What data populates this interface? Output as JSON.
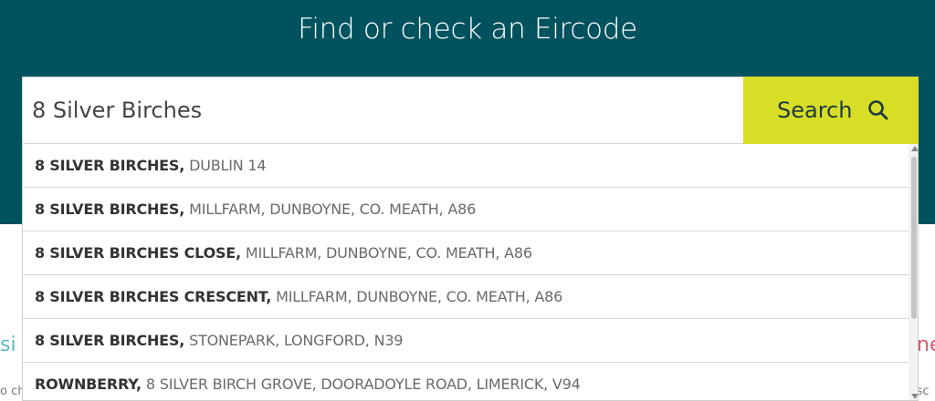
{
  "header": {
    "title": "Find or check an Eircode"
  },
  "search": {
    "value": "8 Silver Birches",
    "placeholder": "",
    "button_label": "Search",
    "icon": "search-icon"
  },
  "suggestions": [
    {
      "primary": "8 SILVER BIRCHES,",
      "secondary": "DUBLIN 14"
    },
    {
      "primary": "8 SILVER BIRCHES,",
      "secondary": "MILLFARM, DUNBOYNE, CO. MEATH, A86"
    },
    {
      "primary": "8 SILVER BIRCHES CLOSE,",
      "secondary": "MILLFARM, DUNBOYNE, CO. MEATH, A86"
    },
    {
      "primary": "8 SILVER BIRCHES CRESCENT,",
      "secondary": "MILLFARM, DUNBOYNE, CO. MEATH, A86"
    },
    {
      "primary": "8 SILVER BIRCHES,",
      "secondary": "STONEPARK, LONGFORD, N39"
    },
    {
      "primary": "ROWNBERRY,",
      "secondary": "8 SILVER BIRCH GROVE, DOORADOYLE ROAD, LIMERICK, V94"
    }
  ],
  "background_fragments": {
    "left": "si",
    "right": "ne",
    "bottom_left": "o ch",
    "bottom_right": "isc"
  },
  "colors": {
    "header_bg": "#00525e",
    "button_bg": "#d8de26",
    "button_text": "#1f3a3f"
  }
}
